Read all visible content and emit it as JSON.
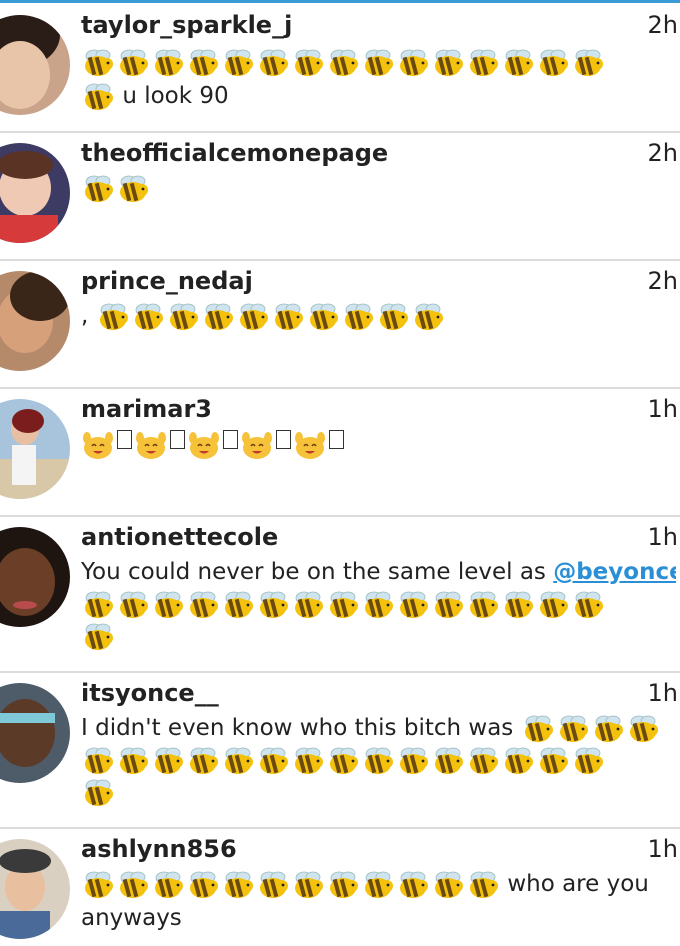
{
  "comments": [
    {
      "username": "taylor_sparkle_j",
      "time": "2h",
      "lines": [
        {
          "pre": "",
          "bees": 15,
          "post": ""
        },
        {
          "pre": "",
          "bees": 1,
          "post": "u look 90"
        }
      ]
    },
    {
      "username": "theofficialcemonepage",
      "time": "2h",
      "lines": [
        {
          "pre": "",
          "bees": 2,
          "post": ""
        }
      ]
    },
    {
      "username": "prince_nedaj",
      "time": "2h",
      "lines": [
        {
          "pre": ",",
          "bees": 10,
          "post": ""
        }
      ]
    },
    {
      "username": "marimar3",
      "time": "1h",
      "lines": [
        {
          "pre": "",
          "smiles": 5,
          "post": ""
        }
      ]
    },
    {
      "username": "antionettecole",
      "time": "1h",
      "lines": [
        {
          "pre": "You could never be on the same level as ",
          "mention": "@beyonce",
          "bees": 0,
          "post": ""
        },
        {
          "pre": "",
          "bees": 15,
          "post": ""
        },
        {
          "pre": "",
          "bees": 1,
          "post": ""
        }
      ]
    },
    {
      "username": "itsyonce__",
      "time": "1h",
      "lines": [
        {
          "pre": "I didn't even know who this bitch was ",
          "bees": 4,
          "post": ""
        },
        {
          "pre": "",
          "bees": 15,
          "post": ""
        },
        {
          "pre": "",
          "bees": 1,
          "post": ""
        }
      ]
    },
    {
      "username": "ashlynn856",
      "time": "1h",
      "lines": [
        {
          "pre": "",
          "bees": 12,
          "post": "who are you"
        },
        {
          "pre": "anyways",
          "bees": 0,
          "post": ""
        }
      ]
    }
  ],
  "icons": {
    "bee": "honeybee-icon",
    "smile": "raised-hands-icon",
    "box": "missing-glyph-icon"
  },
  "colors": {
    "accent": "#3b9bd6",
    "mention": "#2b8fd6",
    "divider": "#dcdcdc"
  }
}
